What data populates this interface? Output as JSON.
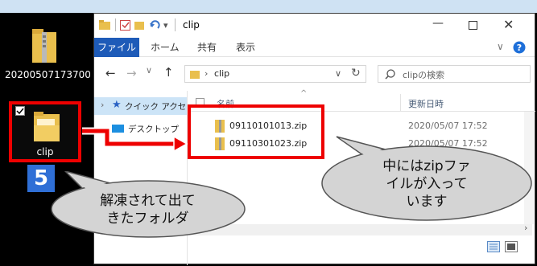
{
  "desktop": {
    "zip_label": "20200507173700...",
    "folder_label": "clip",
    "step_number": "5"
  },
  "window": {
    "title": "clip",
    "ribbon_tabs": [
      "ファイル",
      "ホーム",
      "共有",
      "表示"
    ],
    "address_path": "clip",
    "search_placeholder": "clipの検索",
    "nav_items": [
      "クイック アクセ",
      "デスクトップ"
    ],
    "column_headers": {
      "name": "名前",
      "date": "更新日時"
    },
    "files": [
      {
        "name": "09110101013.zip",
        "date": "2020/05/07 17:52"
      },
      {
        "name": "09110301023.zip",
        "date": "2020/05/07 17:52"
      }
    ]
  },
  "callouts": {
    "left_lines": [
      "解凍されて出て",
      "きたフォルダ"
    ],
    "right_lines": [
      "中にはzipファ",
      "イルが入って",
      "います"
    ]
  },
  "colors": {
    "highlight_red": "#e00000",
    "step_badge_blue": "#2f6fd6",
    "file_tab_blue": "#1e5bb8",
    "folder_yellow": "#e9bf4d",
    "callout_gray": "#d4d4d4"
  }
}
